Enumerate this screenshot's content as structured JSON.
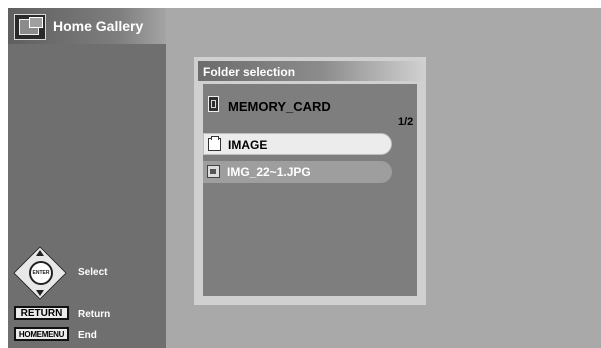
{
  "app": {
    "title": "Home Gallery",
    "icon": "gallery-icon"
  },
  "dialog": {
    "title": "Folder selection",
    "location": {
      "label": "MEMORY_CARD",
      "icon": "memory-card-icon"
    },
    "page_indicator": "1/2",
    "items": [
      {
        "label": "IMAGE",
        "type": "folder",
        "icon": "folder-icon",
        "selected": true
      },
      {
        "label": "IMG_22~1.JPG",
        "type": "file",
        "icon": "image-file-icon",
        "selected": false
      }
    ]
  },
  "controls": {
    "enter_key": "ENTER",
    "select_label": "Select",
    "return_key": "RETURN",
    "return_label": "Return",
    "homemenu_key": "HOMEMENU",
    "end_label": "End"
  },
  "colors": {
    "screen_bg": "#a9a9a9",
    "sidebar_bg": "#6f6f6f",
    "dialog_bg": "#7e7e7e",
    "selected_row": "#ececec",
    "unselected_row": "#9e9e9e"
  }
}
